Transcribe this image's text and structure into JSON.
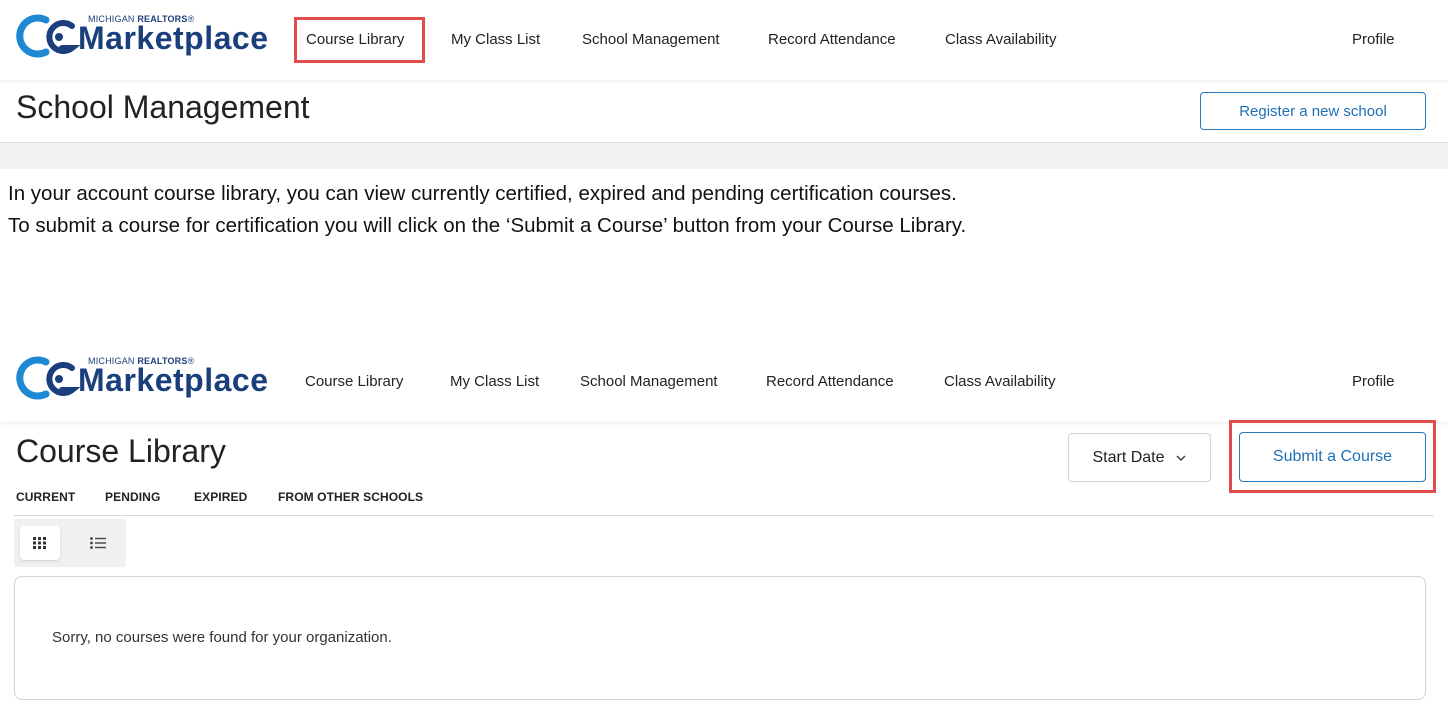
{
  "logo": {
    "small_prefix": "MICHIGAN",
    "small_bold": "REALTORS",
    "small_mark": "®",
    "wordmark": "Marketplace"
  },
  "nav": {
    "items": [
      "Course Library",
      "My Class List",
      "School Management",
      "Record Attendance",
      "Class Availability"
    ],
    "profile": "Profile"
  },
  "school_management": {
    "title": "School Management",
    "register_button": "Register a new school"
  },
  "instruction": {
    "line1": "In your account course library, you can view currently certified, expired and pending certification courses.",
    "line2": "To submit a course for certification you will click on the ‘Submit a Course’ button from your Course Library."
  },
  "course_library": {
    "title": "Course Library",
    "sort_select": "Start Date",
    "submit_button": "Submit a Course",
    "tabs": [
      "CURRENT",
      "PENDING",
      "EXPIRED",
      "FROM OTHER SCHOOLS"
    ],
    "empty_message": "Sorry, no courses were found for your organization."
  },
  "colors": {
    "brand_navy": "#1b3f7d",
    "brand_blue": "#1e88d2",
    "link_blue": "#1f6fb5",
    "highlight_red": "#e04b4b"
  },
  "icons": {
    "grid_view": "grid-icon",
    "list_view": "list-icon",
    "sort_chevron": "chevron-down-icon"
  }
}
